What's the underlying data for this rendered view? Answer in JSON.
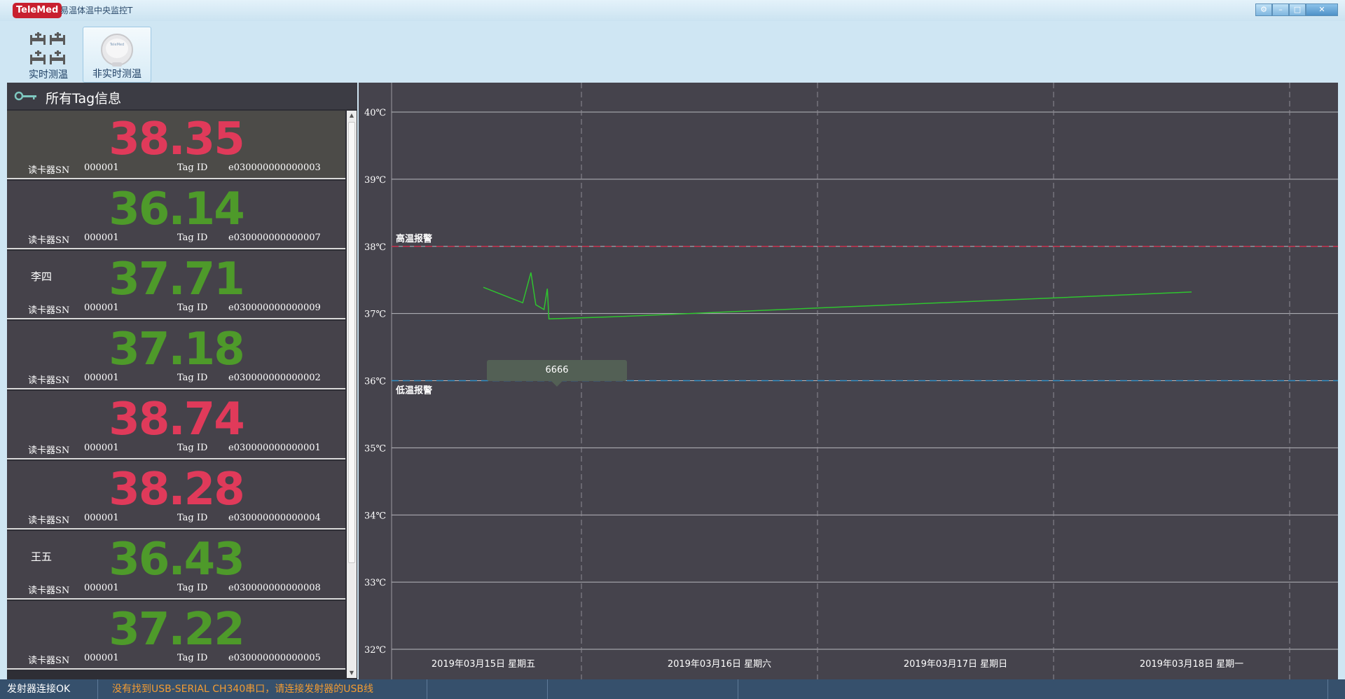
{
  "window": {
    "logo": "TeleMed",
    "title": "易温体温中央监控T",
    "controls": [
      "⚙",
      "–",
      "□",
      "✕"
    ]
  },
  "toolbar": {
    "realtime_label": "实时测温",
    "nonrealtime_label": "非实时测温"
  },
  "panel": {
    "title": "所有Tag信息"
  },
  "labels": {
    "reader": "读卡器SN",
    "tag": "Tag ID"
  },
  "cards": [
    {
      "temp": "38.35",
      "status": "red",
      "name": "",
      "reader_sn": "000001",
      "tag_id": "e030000000000003"
    },
    {
      "temp": "36.14",
      "status": "green",
      "name": "",
      "reader_sn": "000001",
      "tag_id": "e030000000000007"
    },
    {
      "temp": "37.71",
      "status": "green",
      "name": "李四",
      "reader_sn": "000001",
      "tag_id": "e030000000000009"
    },
    {
      "temp": "37.18",
      "status": "green",
      "name": "",
      "reader_sn": "000001",
      "tag_id": "e030000000000002"
    },
    {
      "temp": "38.74",
      "status": "red",
      "name": "",
      "reader_sn": "000001",
      "tag_id": "e030000000000001"
    },
    {
      "temp": "38.28",
      "status": "red",
      "name": "",
      "reader_sn": "000001",
      "tag_id": "e030000000000004"
    },
    {
      "temp": "36.43",
      "status": "green",
      "name": "王五",
      "reader_sn": "000001",
      "tag_id": "e030000000000008"
    },
    {
      "temp": "37.22",
      "status": "green",
      "name": "",
      "reader_sn": "000001",
      "tag_id": "e030000000000005"
    }
  ],
  "chart_data": {
    "type": "line",
    "y_ticks": [
      "40℃",
      "39℃",
      "38℃",
      "37℃",
      "36℃",
      "35℃",
      "34℃",
      "33℃",
      "32℃"
    ],
    "ylim": [
      32,
      40
    ],
    "x_ticks": [
      "2019年03月15日 星期五",
      "2019年03月16日 星期六",
      "2019年03月17日 星期日",
      "2019年03月18日 星期一"
    ],
    "high_alarm": {
      "label": "高温报警",
      "value": 38,
      "color": "#c8324e"
    },
    "low_alarm": {
      "label": "低温报警",
      "value": 36,
      "color": "#2f8fc6"
    },
    "series": [
      {
        "color": "#2fc42f",
        "points": [
          {
            "x": "2019-03-15 00:00",
            "y": 37.39
          },
          {
            "x": "2019-03-15 04:00",
            "y": 37.16
          },
          {
            "x": "2019-03-15 04:50",
            "y": 37.61
          },
          {
            "x": "2019-03-15 05:20",
            "y": 37.13
          },
          {
            "x": "2019-03-15 06:10",
            "y": 37.06
          },
          {
            "x": "2019-03-15 06:30",
            "y": 37.37
          },
          {
            "x": "2019-03-15 06:40",
            "y": 36.92
          },
          {
            "x": "2019-03-15 13:00",
            "y": 36.95
          },
          {
            "x": "2019-03-18 00:00",
            "y": 37.32
          }
        ]
      }
    ],
    "tooltip": "6666",
    "grid": true
  },
  "status": {
    "transmitter": "发射器连接OK",
    "message": "没有找到USB-SERIAL CH340串口，请连接发射器的USB线"
  }
}
